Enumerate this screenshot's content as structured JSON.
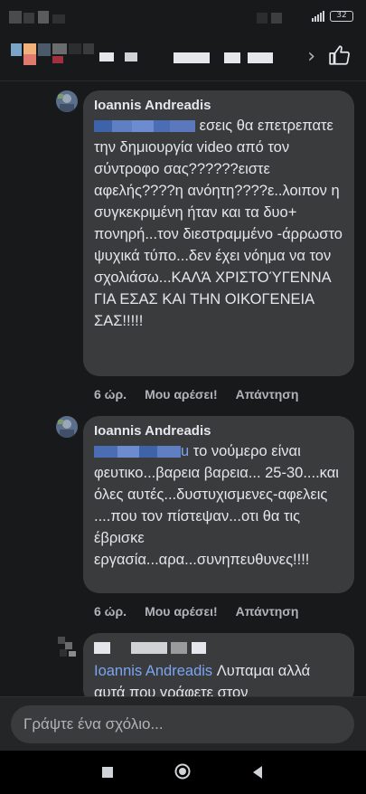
{
  "status": {
    "battery": "32"
  },
  "header": {
    "chevron": "›"
  },
  "comments": [
    {
      "author": "Ioannis Andreadis",
      "text": "εσεις θα επετρεπατε την δημιουργία video από τον σύντροφο σας??????ειστε αφελής????η ανόητη????ε..λοιπον η συγκεκριμένη ήταν και τα δυο+ πονηρή...τον διεστραμμένο -άρρωστο ψυχικά τύπο...δεν έχει νόημα να τον σχολιάσω...ΚΑΛΆ ΧΡΙΣΤΟΎΓΕΝΝΑ ΓΙΑ ΕΣΑΣ ΚΑΙ ΤΗΝ ΟΙΚΟΓΕΝΕΙΑ ΣΑΣ!!!!!",
      "time": "6 ώρ.",
      "like": "Μου αρέσει!",
      "reply": "Απάντηση"
    },
    {
      "author": "Ioannis Andreadis",
      "mention_tail": "u",
      "text": "το νούμερο είναι φευτικο...βαρεια βαρεια... 25-30....και όλες αυτές...δυστυχισμενες-αφελεις ....που τον πίστεψαν...οτι θα τις έβρισκε εργασία...αρα...συνηπευθυνες!!!!",
      "time": "6 ώρ.",
      "like": "Μου αρέσει!",
      "reply": "Απάντηση"
    },
    {
      "mention": "Ioannis Andreadis",
      "text": "Λυπαμαι αλλά αυτά που γράφετε στον"
    }
  ],
  "composer": {
    "placeholder": "Γράψτε ένα σχόλιο..."
  },
  "colors": {
    "background": "#18191a",
    "bubble": "#3a3b3c",
    "mention": "#7aa5f5",
    "muted": "#b0b3b8"
  }
}
